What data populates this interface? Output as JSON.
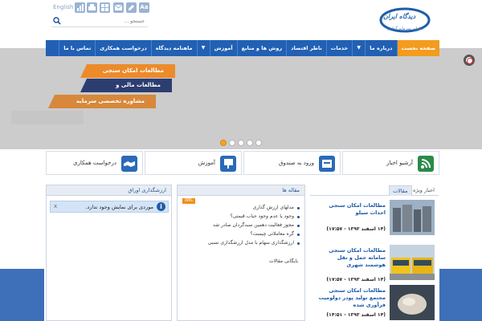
{
  "header": {
    "lang_label": "English",
    "search_placeholder": "جستجو ...",
    "logo_text": "دیدگاه ایران",
    "logo_sub": "مشاور سرمایه گذاری"
  },
  "nav": {
    "items": [
      {
        "label": "صفحه نخست",
        "active": true
      },
      {
        "label": "درباره ما",
        "has_caret": true
      },
      {
        "label": "خدمات"
      },
      {
        "label": "ناظر اقتصاد"
      },
      {
        "label": "روش ها و منابع"
      },
      {
        "label": "آموزش",
        "has_caret": true
      },
      {
        "label": "ماهنامه دیدگاه"
      },
      {
        "label": "درخواست همکاری"
      },
      {
        "label": "تماس با ما"
      }
    ]
  },
  "slider": {
    "ribbons": [
      "مطالعات امکان سنجی",
      "مطالعات مالی و اقتصادی",
      "مشاوره تخصصی سرمایه گذاری"
    ],
    "active_dot": 1,
    "dot_count": 5
  },
  "quick_links": [
    {
      "label": "آرشیو اخبار",
      "icon": "rss-icon",
      "color": "#2a8a48"
    },
    {
      "label": "ورود به صندوق",
      "icon": "fund-icon",
      "color": "#2a6ab8"
    },
    {
      "label": "آموزش",
      "icon": "education-icon",
      "color": "#2a6ab8"
    },
    {
      "label": "درخواست همکاری",
      "icon": "handshake-icon",
      "color": "#2a6ab8"
    }
  ],
  "panel_securities": {
    "title": "ارزشگذاری اوراق",
    "alert_text": "موردی برای نمایش وجود ندارد.",
    "close": "x"
  },
  "panel_articles": {
    "title": "مقاله ها",
    "xml_label": "XML",
    "items": [
      "مدلهای ارزش گذاری",
      "وجود یا عدم وجود حباب قیمتی؟",
      "مجوز فعالیت دهمین سبدگردان صادر شد",
      "گره معاملاتی چیست؟",
      "ارزشگذاری سهام با مدل ارزشگذاری نسبی"
    ],
    "archive_label": "بایگانی مقالات"
  },
  "panel_news": {
    "tabs": [
      "مقالات",
      "اخبار ویژه"
    ],
    "items": [
      {
        "title": "مطالعات امکان سنجی احداث سیلو",
        "date": "(۱۴ اسفند ۱۳۹۳ - ۱۷:۵۷)"
      },
      {
        "title": "مطالعات امکان سنجی سامانه حمل و نقل هوشمند شهری",
        "date": "(۱۴ اسفند ۱۳۹۳ - ۱۷:۵۷)"
      },
      {
        "title": "مطالعات امکان سنجی مجتمع تولید پودر دولومیت فرآوری شده",
        "date": "(۱۴ اسفند ۱۳۹۳ - ۱۴:۵۱)"
      }
    ]
  }
}
